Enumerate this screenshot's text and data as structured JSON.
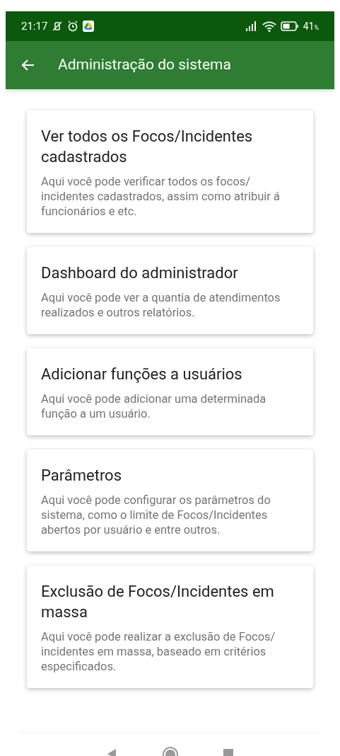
{
  "status_bar": {
    "time": "21:17",
    "battery": "41",
    "battery_unit": "%"
  },
  "app_bar": {
    "title": "Administração do sistema"
  },
  "cards": [
    {
      "title": "Ver todos os Focos/Incidentes cadastrados",
      "description": "Aqui você pode verificar todos os focos/ incidentes cadastrados, assim como atribuir á funcionários e etc."
    },
    {
      "title": "Dashboard do administrador",
      "description": "Aqui você pode ver a quantia de atendimentos realizados e outros relatórios."
    },
    {
      "title": "Adicionar funções a usuários",
      "description": "Aqui você pode adicionar uma determinada função a um usuário."
    },
    {
      "title": "Parâmetros",
      "description": "Aqui você pode configurar os parâmetros do sistema, como o limite de Focos/Incidentes abertos por usuário e entre outros."
    },
    {
      "title": "Exclusão de Focos/Incidentes em massa",
      "description": "Aqui você pode realizar a exclusão de Focos/ incidentes em massa, baseado em critérios especificados."
    }
  ]
}
